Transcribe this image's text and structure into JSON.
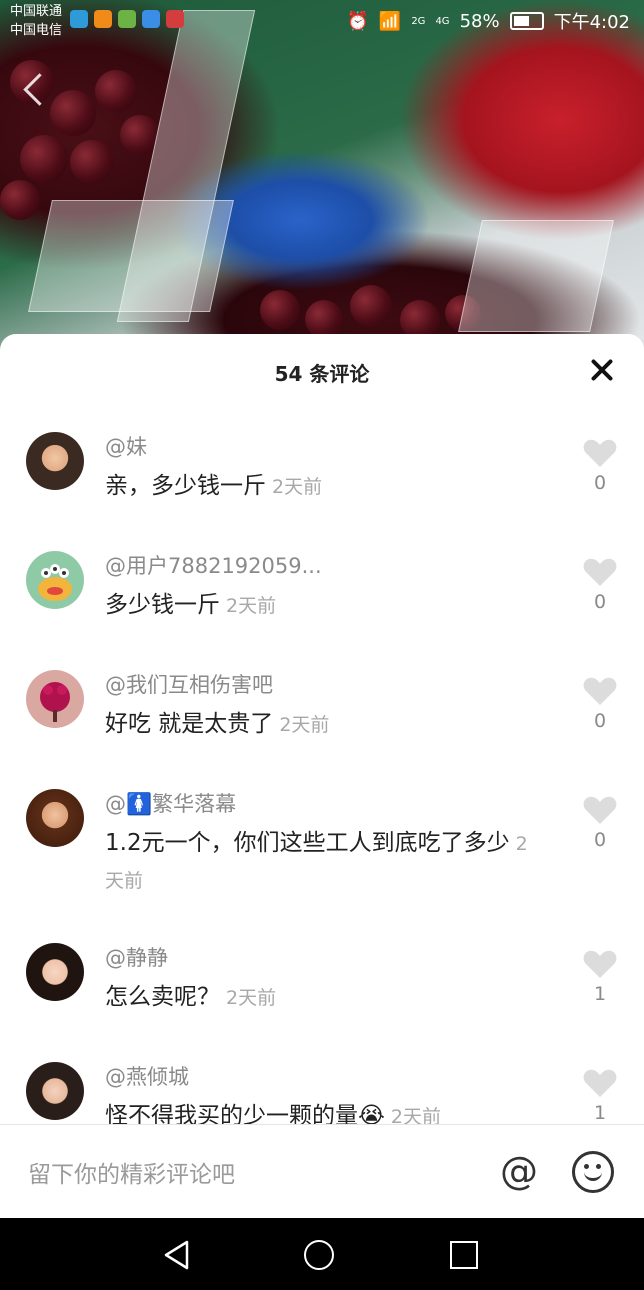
{
  "status_bar": {
    "carrier_1": "中国联通",
    "carrier_2": "中国电信",
    "battery_percent": "58%",
    "time": "下午4:02",
    "network_labels": [
      "2G",
      "4G"
    ]
  },
  "sheet": {
    "title": "54 条评论"
  },
  "comments": [
    {
      "user": "@妹",
      "text": "亲，多少钱一斤",
      "time": "2天前",
      "likes": "0"
    },
    {
      "user": "@用户7882192059...",
      "text": "多少钱一斤",
      "time": "2天前",
      "likes": "0"
    },
    {
      "user": "@我们互相伤害吧",
      "text": "好吃 就是太贵了",
      "time": "2天前",
      "likes": "0"
    },
    {
      "user": "@🚺繁华落幕",
      "text": "1.2元一个，你们这些工人到底吃了多少",
      "time": "2天前",
      "likes": "0"
    },
    {
      "user": "@静静",
      "text": "怎么卖呢？",
      "time": "2天前",
      "likes": "1"
    },
    {
      "user": "@燕倾城",
      "text": "怪不得我买的少一颗的量😭",
      "time": "2天前",
      "likes": "1"
    }
  ],
  "input_bar": {
    "placeholder": "留下你的精彩评论吧",
    "at_symbol": "@"
  },
  "colors": {
    "sheet_bg": "#ffffff",
    "text_primary": "#222222",
    "text_secondary": "#8a8a8a",
    "heart": "#dcdcdc"
  }
}
